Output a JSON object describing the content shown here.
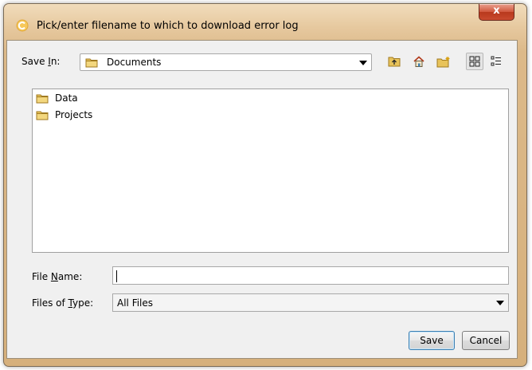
{
  "window": {
    "title": "Pick/enter filename to which to download error log",
    "close_label": "x"
  },
  "save_in": {
    "label_prefix": "Save ",
    "label_mnemonic": "I",
    "label_suffix": "n:",
    "value": "Documents"
  },
  "toolbar": {
    "icons": [
      "up-folder-icon",
      "home-icon",
      "new-folder-icon",
      "list-view-icon",
      "details-view-icon"
    ]
  },
  "files": [
    {
      "name": "Data",
      "icon": "folder-icon"
    },
    {
      "name": "Projects",
      "icon": "folder-icon"
    }
  ],
  "file_name": {
    "label_prefix": "File ",
    "label_mnemonic": "N",
    "label_suffix": "ame:",
    "value": ""
  },
  "file_type": {
    "label_prefix": "Files of ",
    "label_mnemonic": "T",
    "label_suffix": "ype:",
    "value": "All Files"
  },
  "buttons": {
    "save": "Save",
    "cancel": "Cancel"
  },
  "colors": {
    "title_bar": "#e6c89e",
    "close_button": "#c94a2e",
    "folder": "#e8c35a"
  }
}
